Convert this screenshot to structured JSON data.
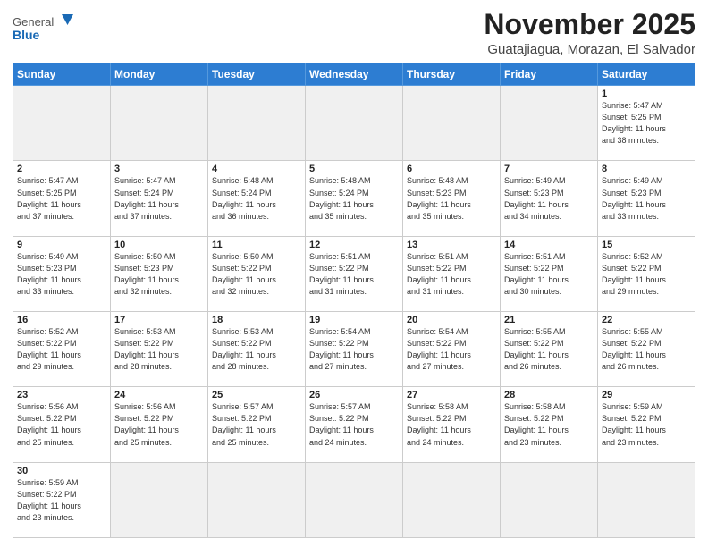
{
  "header": {
    "logo_general": "General",
    "logo_blue": "Blue",
    "month_title": "November 2025",
    "location": "Guatajiagua, Morazan, El Salvador"
  },
  "weekdays": [
    "Sunday",
    "Monday",
    "Tuesday",
    "Wednesday",
    "Thursday",
    "Friday",
    "Saturday"
  ],
  "weeks": [
    [
      {
        "date": "",
        "info": ""
      },
      {
        "date": "",
        "info": ""
      },
      {
        "date": "",
        "info": ""
      },
      {
        "date": "",
        "info": ""
      },
      {
        "date": "",
        "info": ""
      },
      {
        "date": "",
        "info": ""
      },
      {
        "date": "1",
        "info": "Sunrise: 5:47 AM\nSunset: 5:25 PM\nDaylight: 11 hours\nand 38 minutes."
      }
    ],
    [
      {
        "date": "2",
        "info": "Sunrise: 5:47 AM\nSunset: 5:25 PM\nDaylight: 11 hours\nand 37 minutes."
      },
      {
        "date": "3",
        "info": "Sunrise: 5:47 AM\nSunset: 5:24 PM\nDaylight: 11 hours\nand 37 minutes."
      },
      {
        "date": "4",
        "info": "Sunrise: 5:48 AM\nSunset: 5:24 PM\nDaylight: 11 hours\nand 36 minutes."
      },
      {
        "date": "5",
        "info": "Sunrise: 5:48 AM\nSunset: 5:24 PM\nDaylight: 11 hours\nand 35 minutes."
      },
      {
        "date": "6",
        "info": "Sunrise: 5:48 AM\nSunset: 5:23 PM\nDaylight: 11 hours\nand 35 minutes."
      },
      {
        "date": "7",
        "info": "Sunrise: 5:49 AM\nSunset: 5:23 PM\nDaylight: 11 hours\nand 34 minutes."
      },
      {
        "date": "8",
        "info": "Sunrise: 5:49 AM\nSunset: 5:23 PM\nDaylight: 11 hours\nand 33 minutes."
      }
    ],
    [
      {
        "date": "9",
        "info": "Sunrise: 5:49 AM\nSunset: 5:23 PM\nDaylight: 11 hours\nand 33 minutes."
      },
      {
        "date": "10",
        "info": "Sunrise: 5:50 AM\nSunset: 5:23 PM\nDaylight: 11 hours\nand 32 minutes."
      },
      {
        "date": "11",
        "info": "Sunrise: 5:50 AM\nSunset: 5:22 PM\nDaylight: 11 hours\nand 32 minutes."
      },
      {
        "date": "12",
        "info": "Sunrise: 5:51 AM\nSunset: 5:22 PM\nDaylight: 11 hours\nand 31 minutes."
      },
      {
        "date": "13",
        "info": "Sunrise: 5:51 AM\nSunset: 5:22 PM\nDaylight: 11 hours\nand 31 minutes."
      },
      {
        "date": "14",
        "info": "Sunrise: 5:51 AM\nSunset: 5:22 PM\nDaylight: 11 hours\nand 30 minutes."
      },
      {
        "date": "15",
        "info": "Sunrise: 5:52 AM\nSunset: 5:22 PM\nDaylight: 11 hours\nand 29 minutes."
      }
    ],
    [
      {
        "date": "16",
        "info": "Sunrise: 5:52 AM\nSunset: 5:22 PM\nDaylight: 11 hours\nand 29 minutes."
      },
      {
        "date": "17",
        "info": "Sunrise: 5:53 AM\nSunset: 5:22 PM\nDaylight: 11 hours\nand 28 minutes."
      },
      {
        "date": "18",
        "info": "Sunrise: 5:53 AM\nSunset: 5:22 PM\nDaylight: 11 hours\nand 28 minutes."
      },
      {
        "date": "19",
        "info": "Sunrise: 5:54 AM\nSunset: 5:22 PM\nDaylight: 11 hours\nand 27 minutes."
      },
      {
        "date": "20",
        "info": "Sunrise: 5:54 AM\nSunset: 5:22 PM\nDaylight: 11 hours\nand 27 minutes."
      },
      {
        "date": "21",
        "info": "Sunrise: 5:55 AM\nSunset: 5:22 PM\nDaylight: 11 hours\nand 26 minutes."
      },
      {
        "date": "22",
        "info": "Sunrise: 5:55 AM\nSunset: 5:22 PM\nDaylight: 11 hours\nand 26 minutes."
      }
    ],
    [
      {
        "date": "23",
        "info": "Sunrise: 5:56 AM\nSunset: 5:22 PM\nDaylight: 11 hours\nand 25 minutes."
      },
      {
        "date": "24",
        "info": "Sunrise: 5:56 AM\nSunset: 5:22 PM\nDaylight: 11 hours\nand 25 minutes."
      },
      {
        "date": "25",
        "info": "Sunrise: 5:57 AM\nSunset: 5:22 PM\nDaylight: 11 hours\nand 25 minutes."
      },
      {
        "date": "26",
        "info": "Sunrise: 5:57 AM\nSunset: 5:22 PM\nDaylight: 11 hours\nand 24 minutes."
      },
      {
        "date": "27",
        "info": "Sunrise: 5:58 AM\nSunset: 5:22 PM\nDaylight: 11 hours\nand 24 minutes."
      },
      {
        "date": "28",
        "info": "Sunrise: 5:58 AM\nSunset: 5:22 PM\nDaylight: 11 hours\nand 23 minutes."
      },
      {
        "date": "29",
        "info": "Sunrise: 5:59 AM\nSunset: 5:22 PM\nDaylight: 11 hours\nand 23 minutes."
      }
    ],
    [
      {
        "date": "30",
        "info": "Sunrise: 5:59 AM\nSunset: 5:22 PM\nDaylight: 11 hours\nand 23 minutes."
      },
      {
        "date": "",
        "info": ""
      },
      {
        "date": "",
        "info": ""
      },
      {
        "date": "",
        "info": ""
      },
      {
        "date": "",
        "info": ""
      },
      {
        "date": "",
        "info": ""
      },
      {
        "date": "",
        "info": ""
      }
    ]
  ]
}
